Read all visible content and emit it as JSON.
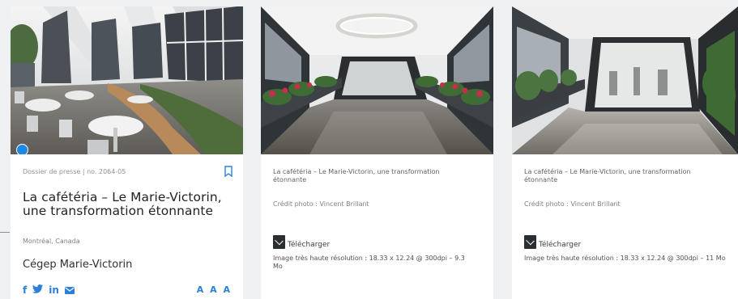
{
  "cards": {
    "main": {
      "meta": "Dossier de presse | no. 2064-05",
      "title": "La cafétéria – Le Marie-Victorin, une transformation étonnante",
      "location": "Montréal, Canada",
      "organization": "Cégep Marie-Victorin",
      "social": [
        "f",
        "t",
        "in"
      ],
      "font_size_control": "A A A",
      "icons": [
        "bookmark-icon",
        "facebook-icon",
        "twitter-icon",
        "linkedin-icon",
        "mail-icon"
      ],
      "accent_color": "#2b80d9"
    },
    "photo_2": {
      "caption": "La cafétéria – Le Marie-Victorin, une transformation étonnante",
      "credit": "Crédit photo : Vincent Brillant",
      "download_label": "Télécharger",
      "resolution": "Image très haute résolution : 18.33 x 12.24 @ 300dpi – 9.3 Mo"
    },
    "photo_3": {
      "caption": "La cafétéria – Le Marie-Victorin, une transformation étonnante",
      "credit": "Crédit photo : Vincent Brillant",
      "download_label": "Télécharger",
      "resolution": "Image très haute résolution : 18.33 x 12.24 @ 300dpi – 11 Mo"
    }
  }
}
